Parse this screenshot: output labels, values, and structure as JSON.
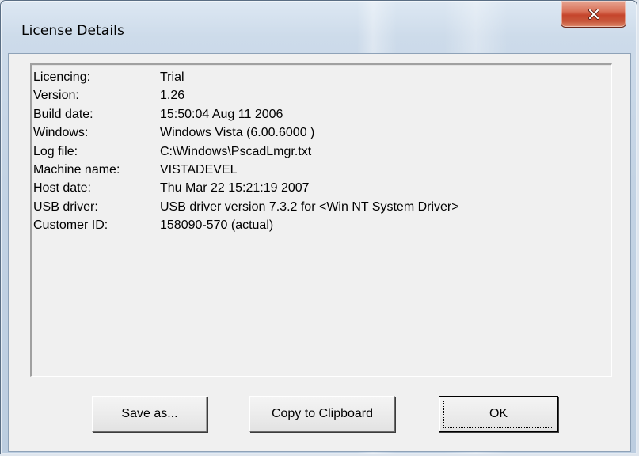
{
  "window": {
    "title": "License Details"
  },
  "close_button": {
    "icon": "close-icon",
    "color": "#c7402a"
  },
  "details": [
    {
      "label": "Licencing:",
      "value": "Trial"
    },
    {
      "label": "Version:",
      "value": "1.26"
    },
    {
      "label": "Build date:",
      "value": "15:50:04  Aug 11 2006"
    },
    {
      "label": "Windows:",
      "value": "Windows Vista (6.00.6000 )"
    },
    {
      "label": "Log file:",
      "value": "C:\\Windows\\PscadLmgr.txt"
    },
    {
      "label": "Machine name:",
      "value": "VISTADEVEL"
    },
    {
      "label": "Host date:",
      "value": "Thu Mar 22 15:21:19 2007"
    },
    {
      "label": "USB driver:",
      "value": "USB driver version 7.3.2 for <Win NT System Driver>"
    },
    {
      "label": "Customer ID:",
      "value": "158090-570 (actual)"
    }
  ],
  "buttons": {
    "save_as": "Save as...",
    "copy_to_clipboard": "Copy to Clipboard",
    "ok": "OK"
  }
}
